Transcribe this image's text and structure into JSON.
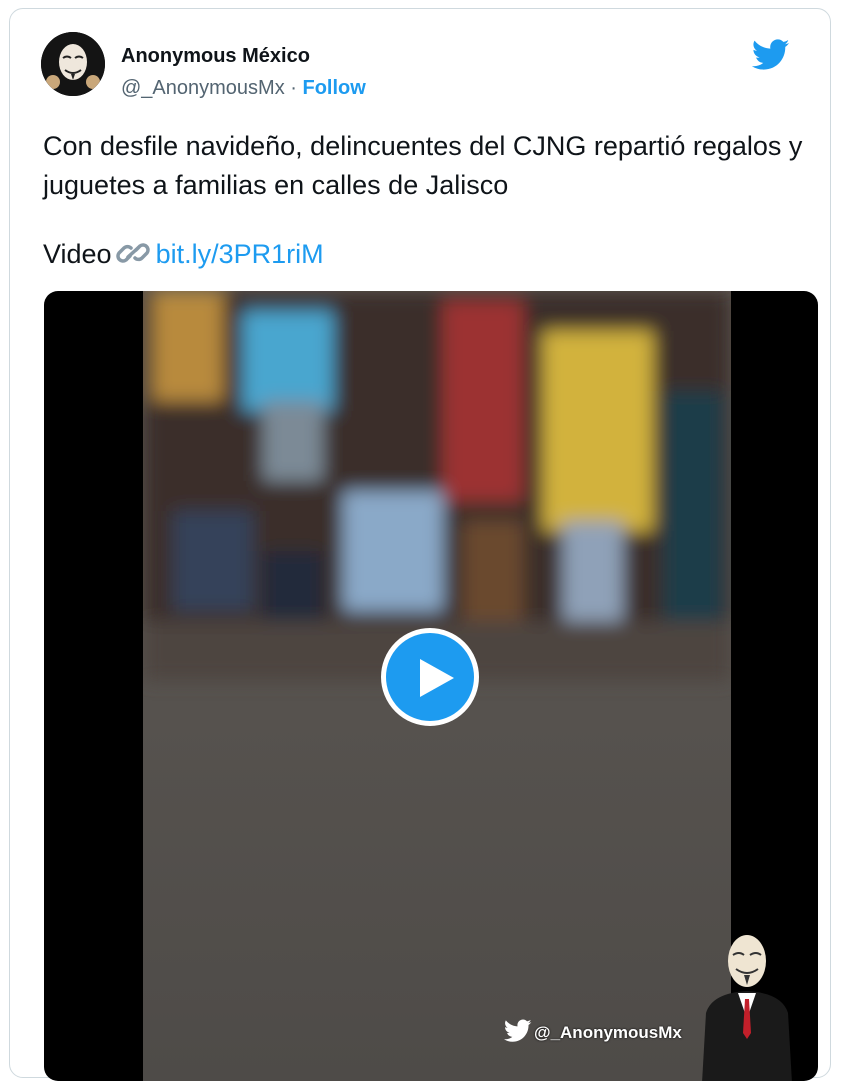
{
  "author": {
    "display_name": "Anonymous México",
    "handle": "@_AnonymousMx",
    "separator": "·",
    "follow_label": "Follow",
    "avatar": "anonymous-mask-avatar"
  },
  "tweet": {
    "text": "Con desfile navideño, delincuentes del CJNG repartió regalos y juguetes a familias en calles de Jalisco",
    "link_prefix": "Video",
    "link_icon": "link-icon",
    "link_text": "bit.ly/3PR1riM"
  },
  "media": {
    "type": "video",
    "play_icon": "play-icon",
    "watermark": "@_AnonymousMx"
  },
  "colors": {
    "accent": "#1d9bf0",
    "text": "#0f1419",
    "secondary": "#536471",
    "border": "#cfd9de"
  }
}
